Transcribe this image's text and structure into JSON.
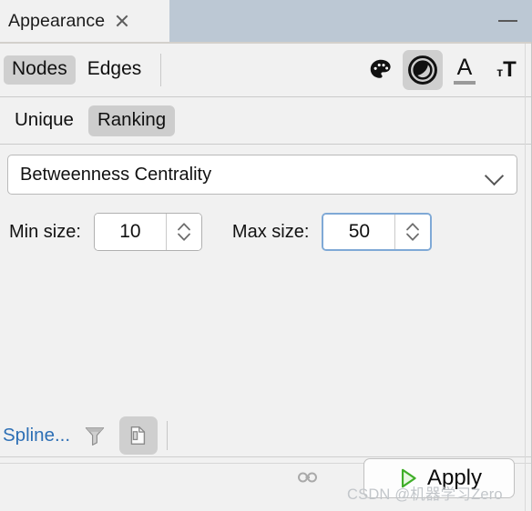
{
  "window": {
    "tab_title": "Appearance",
    "close_icon": "close-icon",
    "minimize_icon": "minimize-icon",
    "titlebar_color": "#bcc8d4"
  },
  "toolbar": {
    "segments": [
      {
        "label": "Nodes",
        "active": true
      },
      {
        "label": "Edges",
        "active": false
      }
    ],
    "icons": [
      {
        "name": "palette-icon",
        "title": "Color",
        "active": false
      },
      {
        "name": "node-size-icon",
        "title": "Size",
        "active": true
      },
      {
        "name": "label-color-icon",
        "title": "Label Color",
        "active": false
      },
      {
        "name": "label-size-icon",
        "title": "Label Size",
        "active": false
      }
    ]
  },
  "mode_row": {
    "items": [
      {
        "label": "Unique",
        "active": false
      },
      {
        "label": "Ranking",
        "active": true
      }
    ]
  },
  "ranking": {
    "attribute_selected": "Betweenness Centrality",
    "chevron_icon": "chevron-down-icon",
    "min_label": "Min size:",
    "min_value": "10",
    "max_label": "Max size:",
    "max_value": "50"
  },
  "links_row": {
    "spline_label": "Spline...",
    "filter_icon": "funnel-icon",
    "copy_icon": "copy-document-icon"
  },
  "footer": {
    "chain_icon": "chain-link-icon",
    "apply_label": "Apply",
    "apply_play_icon": "play-triangle-icon",
    "apply_accent": "#4caf2f",
    "watermark": "CSDN @机器学习Zero"
  }
}
